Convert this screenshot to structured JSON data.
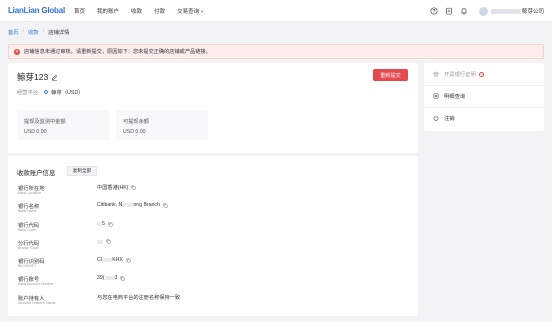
{
  "header": {
    "logo": "LianLian Global",
    "nav": [
      {
        "label": "首页"
      },
      {
        "label": "我的账户"
      },
      {
        "label": "收款"
      },
      {
        "label": "付款"
      },
      {
        "label": "交易查询"
      }
    ],
    "user_suffix": "鲸芽公司"
  },
  "breadcrumb": {
    "home": "首页",
    "parent": "收款",
    "current": "店铺详情"
  },
  "alert": {
    "message": "店铺信息未通过审核。请重新提交，原因如下：您未提交正确的店铺或产品链接。"
  },
  "store": {
    "name": "鲸芽123",
    "resubmit_label": "重新提交",
    "platform_label": "经营平台",
    "platform_value": "鲸芽（USD）",
    "stats": [
      {
        "label": "提现及监测中金额",
        "value": "USD 0.00"
      },
      {
        "label": "可提现余额",
        "value": "USD 0.00"
      }
    ]
  },
  "account": {
    "title": "收款账户信息",
    "copy_all_label": "复制全部",
    "rows": [
      {
        "cn": "银行所在地",
        "en": "Bank Location",
        "value": "中国香港(HK)"
      },
      {
        "cn": "银行名称",
        "en": "Bank Name",
        "value_prefix": "Citibank, N",
        "value_suffix": "ong Branch"
      },
      {
        "cn": "银行代码",
        "en": "Bank Code",
        "value_suffix": "5"
      },
      {
        "cn": "分行代码",
        "en": "Branch Code",
        "value_suffix": ""
      },
      {
        "cn": "银行识别码",
        "en": "BIC/SWIFT",
        "value_prefix": "CI",
        "value_suffix": "KHX"
      },
      {
        "cn": "银行账号",
        "en": "Bank Account Number",
        "value_prefix": "39(",
        "value_suffix": "3"
      },
      {
        "cn": "账户持有人",
        "en": "Account Holder's Name",
        "value": "与您在电商平台的注册名称保持一致"
      }
    ]
  },
  "side": {
    "items": [
      {
        "label": "开具银行证明",
        "icon": "bank-icon"
      },
      {
        "label": "明细查询",
        "icon": "list-icon"
      },
      {
        "label": "注销",
        "icon": "power-icon"
      }
    ]
  },
  "colors": {
    "brand": "#2f6fe0",
    "danger": "#e5484d"
  }
}
